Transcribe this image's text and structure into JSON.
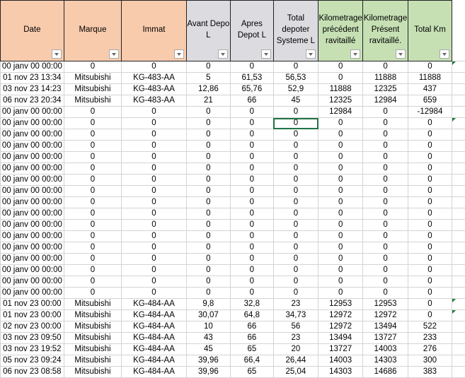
{
  "headers": [
    {
      "label": "Date",
      "color": "o"
    },
    {
      "label": "Marque",
      "color": "o"
    },
    {
      "label": "Immat",
      "color": "o"
    },
    {
      "label": "Avant Depo L",
      "color": "g"
    },
    {
      "label": "Apres Depot L",
      "color": "g"
    },
    {
      "label": "Total depoter Systeme L",
      "color": "g"
    },
    {
      "label": "Kilometrage précédent ravitaillé",
      "color": "gr"
    },
    {
      "label": "Kilometrage Présent ravitaillé.",
      "color": "gr"
    },
    {
      "label": "Total Km",
      "color": "gr"
    }
  ],
  "rows": [
    [
      "00 janv 00 00:00",
      "0",
      "0",
      "0",
      "0",
      "0",
      "0",
      "0",
      "0"
    ],
    [
      "01 nov 23 13:34",
      "Mitsubishi",
      "KG-483-AA",
      "5",
      "61,53",
      "56,53",
      "0",
      "11888",
      "11888"
    ],
    [
      "03 nov 23 14:23",
      "Mitsubishi",
      "KG-483-AA",
      "12,86",
      "65,76",
      "52,9",
      "11888",
      "12325",
      "437"
    ],
    [
      "06 nov 23 20:34",
      "Mitsubishi",
      "KG-483-AA",
      "21",
      "66",
      "45",
      "12325",
      "12984",
      "659"
    ],
    [
      "00 janv 00 00:00",
      "0",
      "0",
      "0",
      "0",
      "0",
      "12984",
      "0",
      "-12984"
    ],
    [
      "00 janv 00 00:00",
      "0",
      "0",
      "0",
      "0",
      "0",
      "0",
      "0",
      "0"
    ],
    [
      "00 janv 00 00:00",
      "0",
      "0",
      "0",
      "0",
      "0",
      "0",
      "0",
      "0"
    ],
    [
      "00 janv 00 00:00",
      "0",
      "0",
      "0",
      "0",
      "0",
      "0",
      "0",
      "0"
    ],
    [
      "00 janv 00 00:00",
      "0",
      "0",
      "0",
      "0",
      "0",
      "0",
      "0",
      "0"
    ],
    [
      "00 janv 00 00:00",
      "0",
      "0",
      "0",
      "0",
      "0",
      "0",
      "0",
      "0"
    ],
    [
      "00 janv 00 00:00",
      "0",
      "0",
      "0",
      "0",
      "0",
      "0",
      "0",
      "0"
    ],
    [
      "00 janv 00 00:00",
      "0",
      "0",
      "0",
      "0",
      "0",
      "0",
      "0",
      "0"
    ],
    [
      "00 janv 00 00:00",
      "0",
      "0",
      "0",
      "0",
      "0",
      "0",
      "0",
      "0"
    ],
    [
      "00 janv 00 00:00",
      "0",
      "0",
      "0",
      "0",
      "0",
      "0",
      "0",
      "0"
    ],
    [
      "00 janv 00 00:00",
      "0",
      "0",
      "0",
      "0",
      "0",
      "0",
      "0",
      "0"
    ],
    [
      "00 janv 00 00:00",
      "0",
      "0",
      "0",
      "0",
      "0",
      "0",
      "0",
      "0"
    ],
    [
      "00 janv 00 00:00",
      "0",
      "0",
      "0",
      "0",
      "0",
      "0",
      "0",
      "0"
    ],
    [
      "00 janv 00 00:00",
      "0",
      "0",
      "0",
      "0",
      "0",
      "0",
      "0",
      "0"
    ],
    [
      "00 janv 00 00:00",
      "0",
      "0",
      "0",
      "0",
      "0",
      "0",
      "0",
      "0"
    ],
    [
      "00 janv 00 00:00",
      "0",
      "0",
      "0",
      "0",
      "0",
      "0",
      "0",
      "0"
    ],
    [
      "00 janv 00 00:00",
      "0",
      "0",
      "0",
      "0",
      "0",
      "0",
      "0",
      "0"
    ],
    [
      "01 nov 23 00:00",
      "Mitsubishi",
      "KG-484-AA",
      "9,8",
      "32,8",
      "23",
      "12953",
      "12953",
      "0"
    ],
    [
      "01 nov 23 00:00",
      "Mitsubishi",
      "KG-484-AA",
      "30,07",
      "64,8",
      "34,73",
      "12972",
      "12972",
      "0"
    ],
    [
      "02 nov 23 00:00",
      "Mitsubishi",
      "KG-484-AA",
      "10",
      "66",
      "56",
      "12972",
      "13494",
      "522"
    ],
    [
      "03 nov 23 09:50",
      "Mitsubishi",
      "KG-484-AA",
      "43",
      "66",
      "23",
      "13494",
      "13727",
      "233"
    ],
    [
      "03 nov 23 19:52",
      "Mitsubishi",
      "KG-484-AA",
      "45",
      "65",
      "20",
      "13727",
      "14003",
      "276"
    ],
    [
      "05 nov 23 09:24",
      "Mitsubishi",
      "KG-484-AA",
      "39,96",
      "66,4",
      "26,44",
      "14003",
      "14303",
      "300"
    ],
    [
      "06 nov 23 08:58",
      "Mitsubishi",
      "KG-484-AA",
      "39,96",
      "65",
      "25,04",
      "14303",
      "14686",
      "383"
    ]
  ],
  "selected_cell": {
    "row": 5,
    "col": 5
  },
  "flagged_rows": [
    0,
    5,
    21,
    22
  ],
  "accent": "#217346"
}
